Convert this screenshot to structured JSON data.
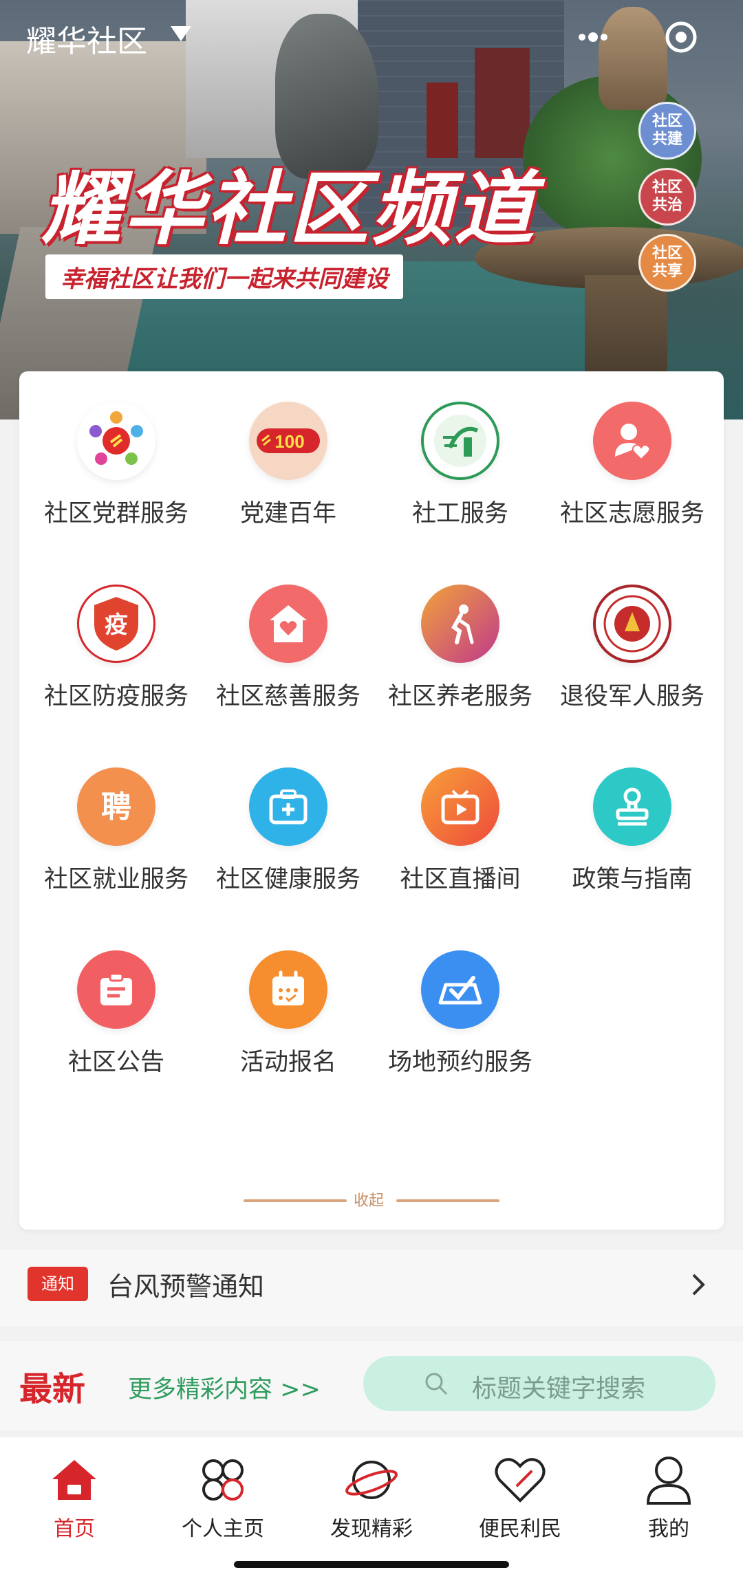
{
  "app": {
    "title": "耀华社区"
  },
  "banner": {
    "title": "耀华社区频道",
    "subtitle": "幸福社区让我们一起来共同建设",
    "tags": [
      "社区共建",
      "社区共治",
      "社区共享"
    ],
    "tag_colors": [
      "#6d8fd2",
      "#c9474c",
      "#e58a44"
    ]
  },
  "services": [
    {
      "label": "社区党群服务",
      "icon": "party-mass-icon",
      "color": "#ffffff"
    },
    {
      "label": "党建百年",
      "icon": "party-100-icon",
      "color": "#f6d7c4"
    },
    {
      "label": "社工服务",
      "icon": "social-work-icon",
      "color": "#ffffff"
    },
    {
      "label": "社区志愿服务",
      "icon": "volunteer-icon",
      "color": "#f36a6a"
    },
    {
      "label": "社区防疫服务",
      "icon": "epidemic-shield-icon",
      "color": "#ffffff"
    },
    {
      "label": "社区慈善服务",
      "icon": "charity-house-icon",
      "color": "#f26a6a"
    },
    {
      "label": "社区养老服务",
      "icon": "elderly-icon",
      "color": "#e59338"
    },
    {
      "label": "退役军人服务",
      "icon": "veteran-badge-icon",
      "color": "#ffffff"
    },
    {
      "label": "社区就业服务",
      "icon": "employment-icon",
      "color": "#f4904e"
    },
    {
      "label": "社区健康服务",
      "icon": "health-kit-icon",
      "color": "#2fb2e8"
    },
    {
      "label": "社区直播间",
      "icon": "live-tv-icon",
      "color": "#f27a3a"
    },
    {
      "label": "政策与指南",
      "icon": "stamp-icon",
      "color": "#2cc9c7"
    },
    {
      "label": "社区公告",
      "icon": "notice-board-icon",
      "color": "#f25f63"
    },
    {
      "label": "活动报名",
      "icon": "calendar-icon",
      "color": "#f68d2e"
    },
    {
      "label": "场地预约服务",
      "icon": "venue-booking-icon",
      "color": "#3b8ff0"
    }
  ],
  "collapse_label": "收起",
  "notice": {
    "badge": "通知",
    "text": "台风预警通知"
  },
  "latest": {
    "title": "最新",
    "more": "更多精彩内容 >>",
    "search_placeholder": "标题关键字搜索"
  },
  "tabs": [
    {
      "label": "首页",
      "icon": "home-icon",
      "active": true
    },
    {
      "label": "个人主页",
      "icon": "profile-grid-icon",
      "active": false
    },
    {
      "label": "发现精彩",
      "icon": "planet-icon",
      "active": false
    },
    {
      "label": "便民利民",
      "icon": "heart-icon",
      "active": false
    },
    {
      "label": "我的",
      "icon": "user-icon",
      "active": false
    }
  ],
  "colors": {
    "accent": "#d6262c",
    "green": "#2f9c5e",
    "search_bg": "#c9f0e1"
  }
}
